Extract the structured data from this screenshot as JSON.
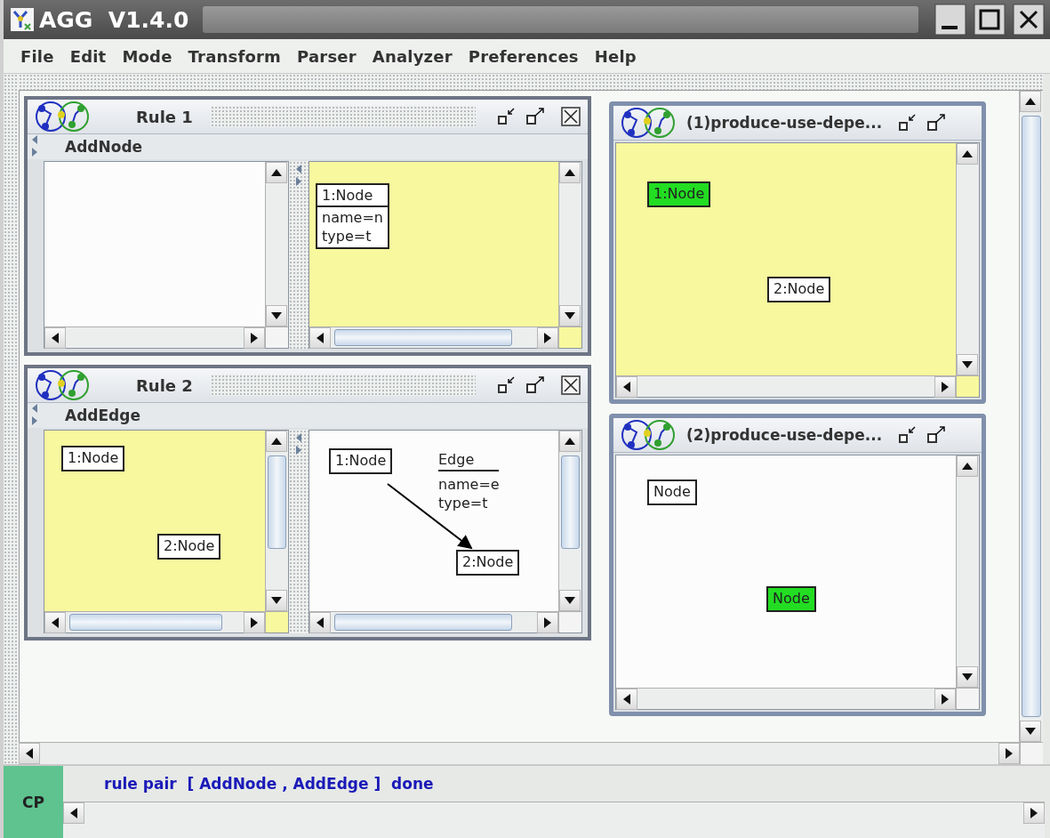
{
  "window": {
    "title": "AGG  V1.4.0"
  },
  "menu": [
    {
      "label": "File"
    },
    {
      "label": "Edit"
    },
    {
      "label": "Mode"
    },
    {
      "label": "Transform"
    },
    {
      "label": "Parser"
    },
    {
      "label": "Analyzer"
    },
    {
      "label": "Preferences"
    },
    {
      "label": "Help"
    }
  ],
  "rule_frames": [
    {
      "title": "Rule 1",
      "closable": true,
      "rule_name": "AddNode",
      "panes": [
        {
          "highlighted": false
        },
        {
          "highlighted": true,
          "nodes": [
            {
              "label": "1:Node",
              "attributes": [
                "name=n",
                "type=t"
              ],
              "marked": false
            }
          ]
        }
      ]
    },
    {
      "title": "Rule 2",
      "closable": true,
      "rule_name": "AddEdge",
      "panes": [
        {
          "highlighted": true,
          "nodes": [
            {
              "label": "1:Node",
              "marked": false
            },
            {
              "label": "2:Node",
              "marked": false
            }
          ]
        },
        {
          "highlighted": false,
          "nodes": [
            {
              "label": "1:Node",
              "marked": false
            },
            {
              "label": "2:Node",
              "marked": false
            }
          ],
          "edges": [
            {
              "label": "Edge",
              "attributes": [
                "name=e",
                "type=t"
              ]
            }
          ]
        }
      ]
    }
  ],
  "pair_frames": [
    {
      "title": "(1)produce-use-depe...",
      "pane": {
        "highlighted": true,
        "nodes": [
          {
            "label": "1:Node",
            "marked": true
          },
          {
            "label": "2:Node",
            "marked": false
          }
        ]
      }
    },
    {
      "title": "(2)produce-use-depe...",
      "pane": {
        "highlighted": false,
        "nodes": [
          {
            "label": "Node",
            "marked": false
          },
          {
            "label": "Node",
            "marked": true
          }
        ]
      }
    }
  ],
  "status": {
    "badge": "CP",
    "message": "rule pair  [ AddNode , AddEdge ]  done"
  }
}
